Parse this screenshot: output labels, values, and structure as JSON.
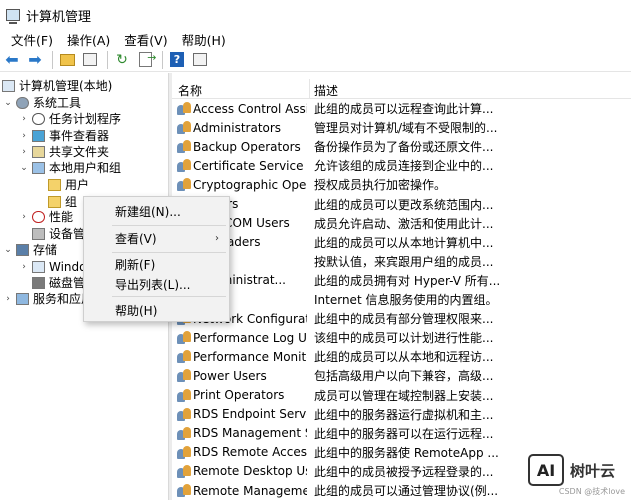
{
  "window": {
    "title": "计算机管理"
  },
  "menubar": [
    "文件(F)",
    "操作(A)",
    "查看(V)",
    "帮助(H)"
  ],
  "toolbar": {
    "buttons": [
      "back-icon",
      "forward-icon",
      "up-folder-icon",
      "show-hide-tree-icon",
      "refresh-icon",
      "export-list-icon",
      "help-icon",
      "properties-icon"
    ]
  },
  "tree": {
    "root": "计算机管理(本地)",
    "items": [
      {
        "label": "系统工具",
        "icon": "gear-icon"
      },
      {
        "label": "任务计划程序",
        "icon": "clock-icon"
      },
      {
        "label": "事件查看器",
        "icon": "event-viewer-icon"
      },
      {
        "label": "共享文件夹",
        "icon": "share-folder-icon"
      },
      {
        "label": "本地用户和组",
        "icon": "users-icon"
      },
      {
        "label": "用户",
        "icon": "folder-icon"
      },
      {
        "label": "组",
        "icon": "folder-icon"
      },
      {
        "label": "性能",
        "icon": "performance-icon"
      },
      {
        "label": "设备管",
        "icon": "device-manager-icon"
      },
      {
        "label": "存储",
        "icon": "storage-icon"
      },
      {
        "label": "Windo",
        "icon": "backup-icon"
      },
      {
        "label": "磁盘管",
        "icon": "disk-icon"
      },
      {
        "label": "服务和应用",
        "icon": "services-icon"
      }
    ]
  },
  "list": {
    "headers": {
      "name": "名称",
      "desc": "描述"
    },
    "rows": [
      {
        "name": "Access Control Assist...",
        "desc": "此组的成员可以远程查询此计算..."
      },
      {
        "name": "Administrators",
        "desc": "管理员对计算机/域有不受限制的..."
      },
      {
        "name": "Backup Operators",
        "desc": "备份操作员为了备份或还原文件..."
      },
      {
        "name": "Certificate Service D...",
        "desc": "允许该组的成员连接到企业中的..."
      },
      {
        "name": "Cryptographic Operat...",
        "desc": "授权成员执行加密操作。"
      },
      {
        "name": "Owners",
        "desc": "此组的成员可以更改系统范围内..."
      },
      {
        "name": "uted COM Users",
        "desc": "成员允许启动、激活和使用此计..."
      },
      {
        "name": "og Readers",
        "desc": "此组的成员可以从本地计算机中..."
      },
      {
        "name": "",
        "desc": "按默认值，来宾跟用户组的成员..."
      },
      {
        "name": "V Administrat...",
        "desc": "此组的成员拥有对 Hyper-V 所有..."
      },
      {
        "name": "RS",
        "desc": "Internet 信息服务使用的内置组。"
      },
      {
        "name": "Network Configuratio...",
        "desc": "此组中的成员有部分管理权限来..."
      },
      {
        "name": "Performance Log Users",
        "desc": "该组中的成员可以计划进行性能..."
      },
      {
        "name": "Performance Monitor...",
        "desc": "此组的成员可以从本地和远程访..."
      },
      {
        "name": "Power Users",
        "desc": "包括高级用户以向下兼容，高级..."
      },
      {
        "name": "Print Operators",
        "desc": "成员可以管理在域控制器上安装..."
      },
      {
        "name": "RDS Endpoint Servers",
        "desc": "此组中的服务器运行虚拟机和主..."
      },
      {
        "name": "RDS Management Se...",
        "desc": "此组中的服务器可以在运行远程..."
      },
      {
        "name": "RDS Remote Access ...",
        "desc": "此组中的服务器使 RemoteApp ..."
      },
      {
        "name": "Remote Desktop Users",
        "desc": "此组中的成员被授予远程登录的..."
      },
      {
        "name": "Remote Managemen...",
        "desc": "此组的成员可以通过管理协议(例..."
      }
    ]
  },
  "context_menu": {
    "items": [
      {
        "label": "新建组(N)...",
        "submenu": false
      },
      {
        "label": "查看(V)",
        "submenu": true
      },
      {
        "label": "刷新(F)",
        "submenu": false
      },
      {
        "label": "导出列表(L)...",
        "submenu": false
      },
      {
        "label": "帮助(H)",
        "submenu": false
      }
    ],
    "submenu_arrow": "›"
  },
  "watermark": {
    "logo": "AI",
    "text": "树叶云"
  },
  "credit": "CSDN @技术love"
}
